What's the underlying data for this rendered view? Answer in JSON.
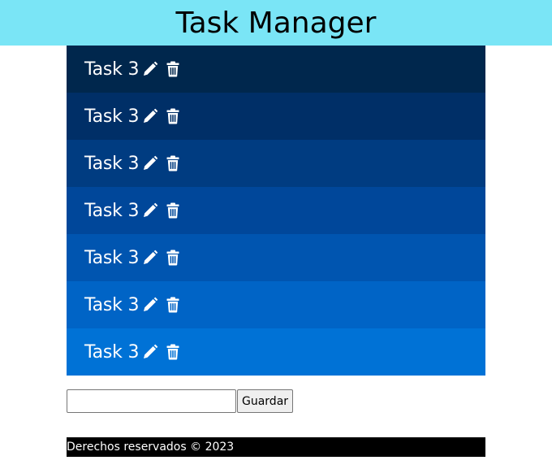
{
  "header": {
    "title": "Task Manager",
    "background": "#7ae5f6"
  },
  "tasks": [
    {
      "label": "Task 3",
      "color": "#00274d"
    },
    {
      "label": "Task 3",
      "color": "#002f67"
    },
    {
      "label": "Task 3",
      "color": "#003c81"
    },
    {
      "label": "Task 3",
      "color": "#00479a"
    },
    {
      "label": "Task 3",
      "color": "#0055b0"
    },
    {
      "label": "Task 3",
      "color": "#0064c6"
    },
    {
      "label": "Task 3",
      "color": "#0072d6"
    }
  ],
  "task_icons": {
    "edit": "pencil-icon",
    "delete": "trash-icon"
  },
  "form": {
    "input_value": "",
    "input_placeholder": "",
    "save_label": "Guardar"
  },
  "footer": {
    "text": "Derechos reservados © 2023"
  }
}
